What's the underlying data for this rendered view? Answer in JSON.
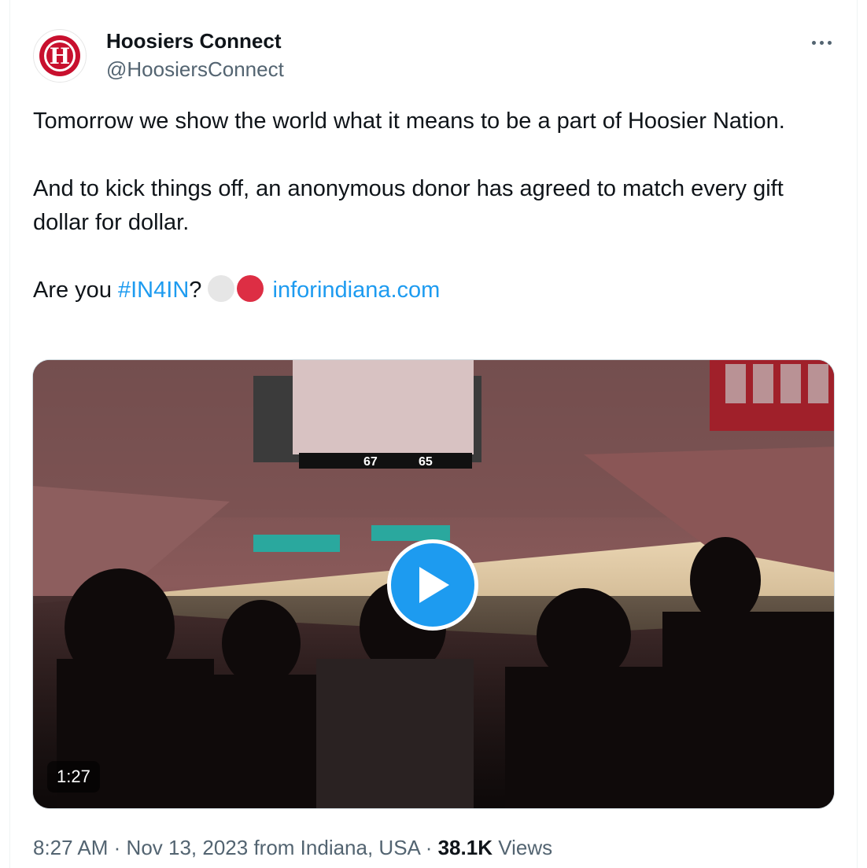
{
  "author": {
    "display_name": "Hoosiers Connect",
    "handle": "@HoosiersConnect",
    "avatar_letter": "H",
    "avatar_color": "#c8102e"
  },
  "tweet": {
    "paragraph_1": "Tomorrow we show the world what it means to be a part of Hoosier Nation.",
    "paragraph_2": "And to kick things off, an anonymous donor has agreed to match every gift dollar for dollar.",
    "cta_prefix": "Are you ",
    "hashtag": "#IN4IN",
    "cta_suffix": "?",
    "emoji_colors": [
      "#e6e6e6",
      "#dd2e44"
    ],
    "link_text": "inforindiana.com",
    "link_color": "#1d9bf0"
  },
  "media": {
    "type": "video",
    "duration": "1:27",
    "play_icon": "play-icon"
  },
  "meta": {
    "time": "8:27 AM",
    "separator": "·",
    "date": "Nov 13, 2023",
    "location": "from Indiana, USA",
    "views_count": "38.1K",
    "views_label": "Views"
  }
}
